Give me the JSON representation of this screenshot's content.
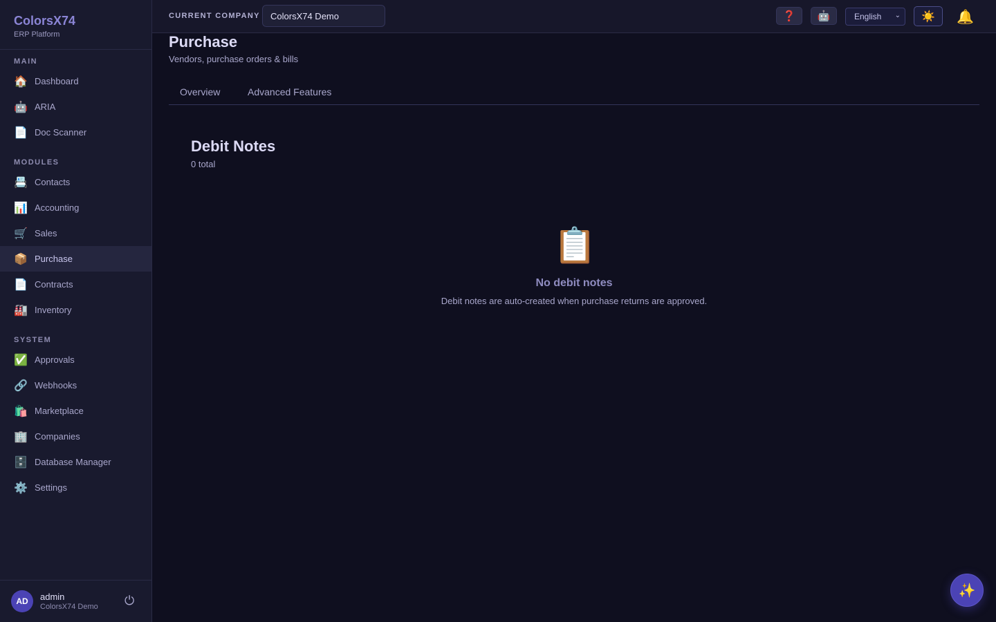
{
  "brand": {
    "name": "ColorsX74",
    "subtitle": "ERP Platform"
  },
  "sidebar": {
    "sections": [
      {
        "label": "MAIN",
        "items": [
          {
            "icon": "🏠",
            "icon_name": "home-icon",
            "label": "Dashboard"
          },
          {
            "icon": "🤖",
            "icon_name": "robot-icon",
            "label": "ARIA"
          },
          {
            "icon": "📄",
            "icon_name": "document-icon",
            "label": "Doc Scanner"
          }
        ]
      },
      {
        "label": "MODULES",
        "items": [
          {
            "icon": "📇",
            "icon_name": "contacts-icon",
            "label": "Contacts"
          },
          {
            "icon": "📊",
            "icon_name": "chart-icon",
            "label": "Accounting"
          },
          {
            "icon": "🛒",
            "icon_name": "cart-icon",
            "label": "Sales"
          },
          {
            "icon": "📦",
            "icon_name": "package-icon",
            "label": "Purchase",
            "active": true
          },
          {
            "icon": "📄",
            "icon_name": "document-icon",
            "label": "Contracts"
          },
          {
            "icon": "🏭",
            "icon_name": "factory-icon",
            "label": "Inventory"
          }
        ]
      },
      {
        "label": "SYSTEM",
        "items": [
          {
            "icon": "✅",
            "icon_name": "checkmark-icon",
            "label": "Approvals"
          },
          {
            "icon": "🔗",
            "icon_name": "link-icon",
            "label": "Webhooks"
          },
          {
            "icon": "🛍️",
            "icon_name": "shopping-bags-icon",
            "label": "Marketplace"
          },
          {
            "icon": "🏢",
            "icon_name": "building-icon",
            "label": "Companies"
          },
          {
            "icon": "🗄️",
            "icon_name": "file-cabinet-icon",
            "label": "Database Manager"
          },
          {
            "icon": "⚙️",
            "icon_name": "gear-icon",
            "label": "Settings"
          }
        ]
      }
    ]
  },
  "user": {
    "initials": "AD",
    "name": "admin",
    "company": "ColorsX74 Demo",
    "logout_icon": "⏻"
  },
  "topbar": {
    "company_label": "CURRENT COMPANY",
    "company_value": "ColorsX74 Demo",
    "help_icon": "❓",
    "assistant_icon": "🤖",
    "language": "English",
    "language_chevron": "⌄",
    "theme_icon": "☀️",
    "notification_icon": "🔔"
  },
  "page": {
    "title": "Purchase",
    "subtitle": "Vendors, purchase orders & bills",
    "tabs": [
      {
        "label": "Overview"
      },
      {
        "label": "Advanced Features"
      }
    ]
  },
  "debit_notes": {
    "title": "Debit Notes",
    "count": "0 total",
    "empty_icon": "📋",
    "empty_title": "No debit notes",
    "empty_desc": "Debit notes are auto-created when purchase returns are approved."
  },
  "fab": {
    "icon": "✨"
  }
}
